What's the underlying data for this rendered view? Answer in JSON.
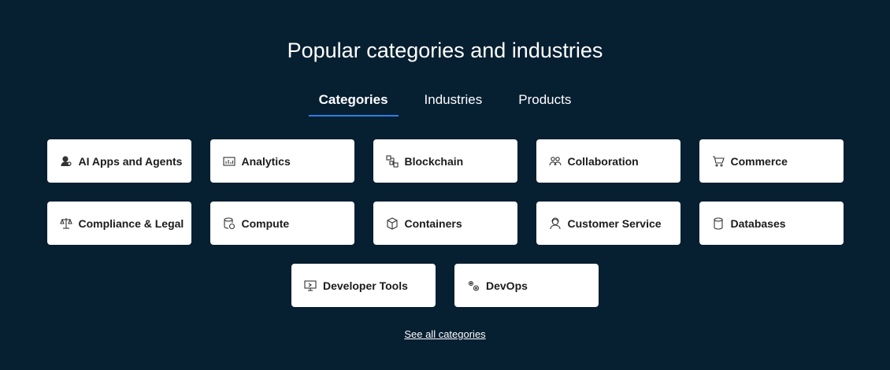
{
  "section": {
    "title": "Popular categories and industries"
  },
  "tabs": [
    {
      "label": "Categories",
      "active": true
    },
    {
      "label": "Industries",
      "active": false
    },
    {
      "label": "Products",
      "active": false
    }
  ],
  "colors": {
    "background": "#061f31",
    "accent_underline": "#2d7fe0",
    "card_background": "#ffffff"
  },
  "categories": [
    {
      "label": "AI Apps and Agents",
      "icon": "ai-agent-icon"
    },
    {
      "label": "Analytics",
      "icon": "analytics-chart-icon"
    },
    {
      "label": "Blockchain",
      "icon": "blockchain-icon"
    },
    {
      "label": "Collaboration",
      "icon": "collaboration-icon"
    },
    {
      "label": "Commerce",
      "icon": "shopping-cart-icon"
    },
    {
      "label": "Compliance & Legal",
      "icon": "scales-icon"
    },
    {
      "label": "Compute",
      "icon": "compute-icon"
    },
    {
      "label": "Containers",
      "icon": "container-cube-icon"
    },
    {
      "label": "Customer Service",
      "icon": "customer-service-icon"
    },
    {
      "label": "Databases",
      "icon": "database-icon"
    },
    {
      "label": "Developer Tools",
      "icon": "developer-tools-icon"
    },
    {
      "label": "DevOps",
      "icon": "gears-icon"
    }
  ],
  "see_all": {
    "label": "See all categories"
  }
}
